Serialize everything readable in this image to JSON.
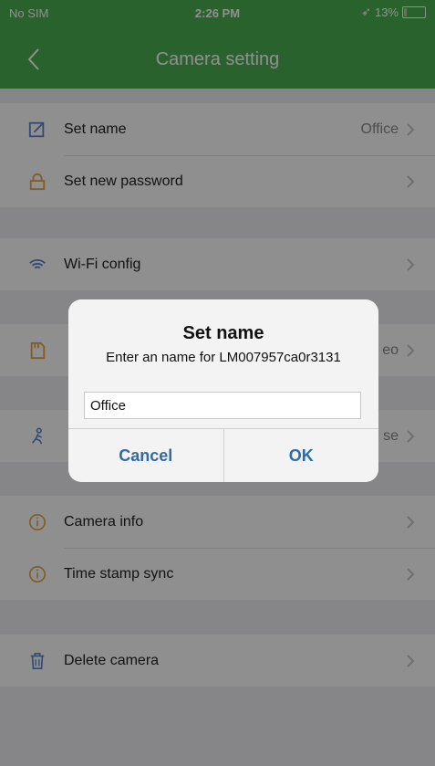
{
  "status": {
    "carrier": "No SIM",
    "time": "2:26 PM",
    "battery": "13%"
  },
  "nav": {
    "title": "Camera setting"
  },
  "settings": [
    {
      "label": "Set name",
      "value": "Office",
      "icon": "edit-icon",
      "color": "#5b86c9"
    },
    {
      "label": "Set new password",
      "value": "",
      "icon": "lock-icon",
      "color": "#e7a44a"
    },
    {
      "label": "Wi-Fi config",
      "value": "",
      "icon": "wifi-icon",
      "color": "#5b86c9"
    },
    {
      "label": "",
      "value": "eo",
      "icon": "sd-card-icon",
      "color": "#e7a44a"
    },
    {
      "label": "",
      "value": "se",
      "icon": "motion-icon",
      "color": "#5b86c9"
    },
    {
      "label": "Camera info",
      "value": "",
      "icon": "info-icon",
      "color": "#e7a44a"
    },
    {
      "label": "Time stamp sync",
      "value": "",
      "icon": "info-icon",
      "color": "#e7a44a"
    },
    {
      "label": "Delete camera",
      "value": "",
      "icon": "trash-icon",
      "color": "#5b86c9"
    }
  ],
  "dialog": {
    "title": "Set name",
    "message": "Enter an name for LM007957ca0r3131",
    "input_value": "Office",
    "cancel_label": "Cancel",
    "ok_label": "OK"
  },
  "colors": {
    "header": "#4caf50",
    "background": "#efeff4",
    "dialog_button": "#2f6aa9"
  }
}
